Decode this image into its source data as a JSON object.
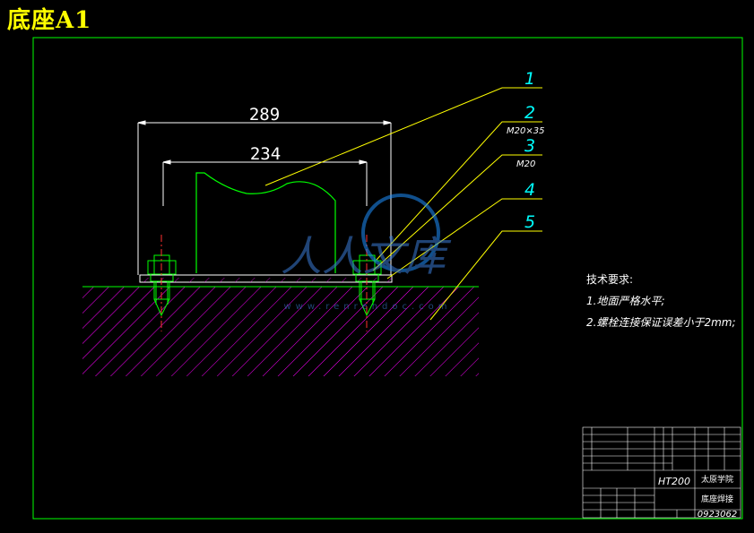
{
  "title": "底座A1",
  "dimensions": {
    "outer": "289",
    "inner": "234"
  },
  "callouts": [
    {
      "number": "1",
      "spec": ""
    },
    {
      "number": "2",
      "spec": "M20×35"
    },
    {
      "number": "3",
      "spec": "M20"
    },
    {
      "number": "4",
      "spec": ""
    },
    {
      "number": "5",
      "spec": ""
    }
  ],
  "technical_requirements": {
    "heading": "技术要求:",
    "items": [
      "1.地面严格水平;",
      "2.螺栓连接保证误差小于2mm;"
    ]
  },
  "title_block": {
    "material": "HT200",
    "school": "太原学院",
    "part_name": "底座焊接",
    "drawing_number": "0923062"
  },
  "watermark": {
    "text": "人人文库",
    "url": "www.renrendoc.com"
  },
  "colors": {
    "background": "#000000",
    "frame": "#00ff00",
    "dimension": "#ffffff",
    "callout": "#ffff00",
    "part_outline": "#00ff00",
    "hatch": "#ff00ff",
    "centerline": "#ff3030",
    "text_cyan": "#00ffff",
    "title": "#ffff00"
  }
}
